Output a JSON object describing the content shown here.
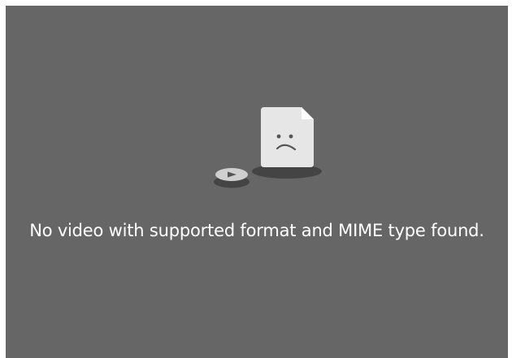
{
  "video_player": {
    "error_message": "No video with supported format and MIME type found.",
    "icons": {
      "document": "sad-document-icon",
      "play": "play-icon"
    },
    "colors": {
      "background": "#666666",
      "text": "#ffffff",
      "document": "#e6e6e6",
      "shadow": "#444444"
    }
  }
}
